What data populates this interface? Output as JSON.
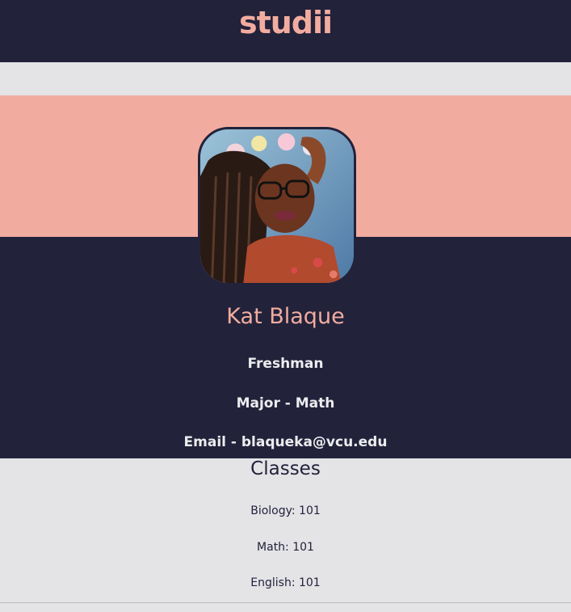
{
  "header": {
    "logo": "studii"
  },
  "profile": {
    "name": "Kat Blaque",
    "year": "Freshman",
    "major": "Major - Math",
    "email": "Email - blaqueka@vcu.edu"
  },
  "classes": {
    "title": "Classes",
    "items": [
      "Biology: 101",
      "Math: 101",
      "English: 101"
    ]
  },
  "colors": {
    "navy": "#22223b",
    "peach": "#f2ac9f",
    "light": "#e4e4e7"
  }
}
